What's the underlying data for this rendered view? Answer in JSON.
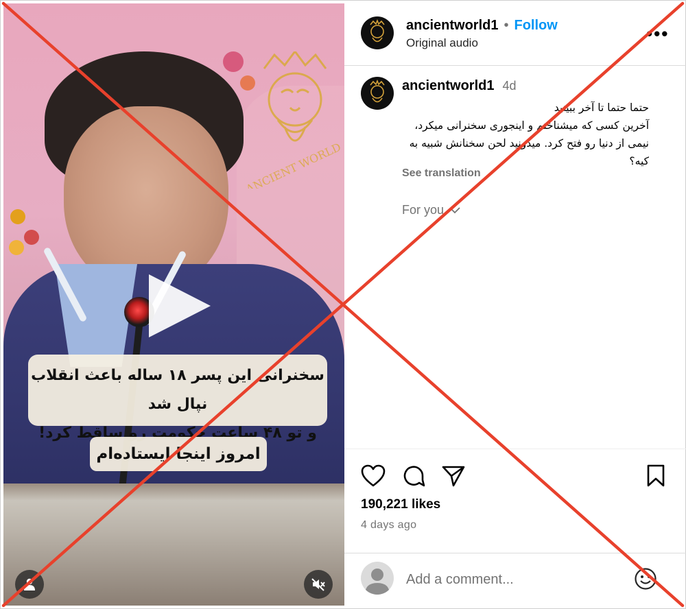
{
  "post": {
    "username": "ancientworld1",
    "follow_label": "Follow",
    "separator": "•",
    "audio": "Original audio",
    "more_label": "•••",
    "avatar_logo_text": "ANCIENT WORLD"
  },
  "comment": {
    "username": "ancientworld1",
    "time": "4d",
    "lines": [
      "حتما حتما تا آخر ببینید",
      "آخرین کسی که میشناختم و اینجوری سخنرانی میکرد،",
      "نیمی از دنیا رو فتح کرد. میدونید لحن سخنانش شبیه به",
      "کیه؟"
    ],
    "see_translation": "See translation",
    "for_you": "For you"
  },
  "video": {
    "caption_line1": "سخنرانی این پسر ۱۸ ساله باعث انقلاب نپال شد",
    "caption_line2": "و تو ۴۸ ساعت حکومت رو ساقط کرد!",
    "caption_line3": "امروز اینجا ایستاده‌ام",
    "watermark": "ANCIENT WORLD"
  },
  "actions": {
    "likes": "190,221 likes",
    "ago": "4 days ago"
  },
  "add_comment": {
    "placeholder": "Add a comment..."
  },
  "icons": {
    "like": "heart-icon",
    "comment": "comment-icon",
    "share": "send-icon",
    "save": "bookmark-icon",
    "emoji": "emoji-icon",
    "user": "user-icon",
    "mute": "muted-speaker-icon",
    "chevron": "chevron-down-icon"
  },
  "colors": {
    "follow": "#0095f6",
    "cross": "#e8412c",
    "muted_text": "#737373"
  }
}
